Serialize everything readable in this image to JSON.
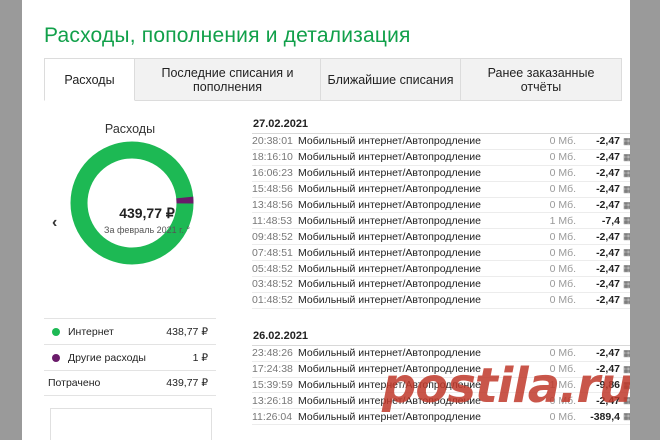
{
  "page_title": "Расходы, пополнения и детализация",
  "tabs": [
    {
      "label": "Расходы",
      "active": true
    },
    {
      "label": "Последние списания и пополнения"
    },
    {
      "label": "Ближайшие списания"
    },
    {
      "label": "Ранее заказанные отчёты"
    }
  ],
  "summary": {
    "title": "Расходы",
    "prev_arrow": "‹",
    "amount": "439,77 ₽",
    "period": "За февраль 2021 г. °",
    "legend": [
      {
        "label": "Интернет",
        "amount": "438,77 ₽",
        "color": "#1db954"
      },
      {
        "label": "Другие расходы",
        "amount": "1 ₽",
        "color": "#6a1b6a"
      }
    ],
    "total_label": "Потрачено",
    "total_amount": "439,77 ₽"
  },
  "chart_data": {
    "type": "pie",
    "categories": [
      "Интернет",
      "Другие расходы"
    ],
    "values": [
      438.77,
      1
    ],
    "colors": [
      "#1db954",
      "#6a1b6a"
    ]
  },
  "details": [
    {
      "date": "27.02.2021",
      "rows": [
        {
          "time": "20:38:01",
          "desc": "Мобильный интернет/Автопродление",
          "mb": "0 Мб.",
          "amount": "-2,47"
        },
        {
          "time": "18:16:10",
          "desc": "Мобильный интернет/Автопродление",
          "mb": "0 Мб.",
          "amount": "-2,47"
        },
        {
          "time": "16:06:23",
          "desc": "Мобильный интернет/Автопродление",
          "mb": "0 Мб.",
          "amount": "-2,47"
        },
        {
          "time": "15:48:56",
          "desc": "Мобильный интернет/Автопродление",
          "mb": "0 Мб.",
          "amount": "-2,47"
        },
        {
          "time": "13:48:56",
          "desc": "Мобильный интернет/Автопродление",
          "mb": "0 Мб.",
          "amount": "-2,47"
        },
        {
          "time": "11:48:53",
          "desc": "Мобильный интернет/Автопродление",
          "mb": "1 Мб.",
          "amount": "-7,4"
        },
        {
          "time": "09:48:52",
          "desc": "Мобильный интернет/Автопродление",
          "mb": "0 Мб.",
          "amount": "-2,47"
        },
        {
          "time": "07:48:51",
          "desc": "Мобильный интернет/Автопродление",
          "mb": "0 Мб.",
          "amount": "-2,47"
        },
        {
          "time": "05:48:52",
          "desc": "Мобильный интернет/Автопродление",
          "mb": "0 Мб.",
          "amount": "-2,47"
        },
        {
          "time": "03:48:52",
          "desc": "Мобильный интернет/Автопродление",
          "mb": "0 Мб.",
          "amount": "-2,47"
        },
        {
          "time": "01:48:52",
          "desc": "Мобильный интернет/Автопродление",
          "mb": "0 Мб.",
          "amount": "-2,47"
        }
      ]
    },
    {
      "date": "26.02.2021",
      "rows": [
        {
          "time": "23:48:26",
          "desc": "Мобильный интернет/Автопродление",
          "mb": "0 Мб.",
          "amount": "-2,47"
        },
        {
          "time": "17:24:38",
          "desc": "Мобильный интернет/Автопродление",
          "mb": "0 Мб.",
          "amount": "-2,47"
        },
        {
          "time": "15:39:59",
          "desc": "Мобильный интернет/Автопродление",
          "mb": "1 Мб.",
          "amount": "-9,86"
        },
        {
          "time": "13:26:18",
          "desc": "Мобильный интернет/Автопродление",
          "mb": "0 Мб.",
          "amount": "-2,47"
        },
        {
          "time": "11:26:04",
          "desc": "Мобильный интернет/Автопродление",
          "mb": "0 Мб.",
          "amount": "-389,4"
        }
      ]
    }
  ],
  "receipt_icon": "receipt-icon",
  "receipt_glyph": "▦",
  "watermark": "postila.ru"
}
